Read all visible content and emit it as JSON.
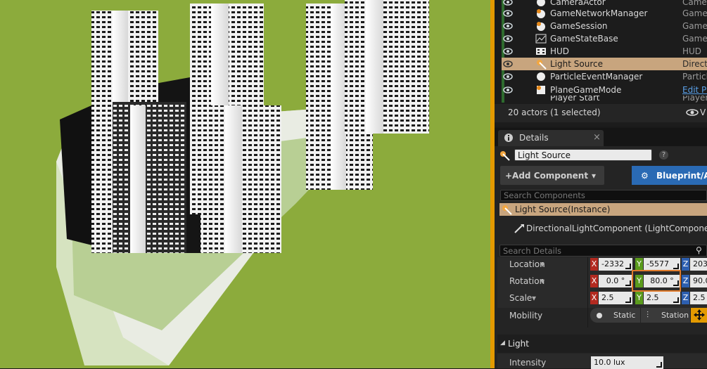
{
  "outliner": {
    "rows": [
      {
        "name": "CameraActor",
        "type": "Came",
        "icon": "camera-actor-icon"
      },
      {
        "name": "GameNetworkManager",
        "type": "GameN",
        "icon": "game-network-manager-icon"
      },
      {
        "name": "GameSession",
        "type": "GameS",
        "icon": "game-session-icon"
      },
      {
        "name": "GameStateBase",
        "type": "GameS",
        "icon": "game-state-icon"
      },
      {
        "name": "HUD",
        "type": "HUD",
        "icon": "hud-icon"
      },
      {
        "name": "Light Source",
        "type": "Directio",
        "icon": "light-source-icon",
        "selected": true
      },
      {
        "name": "ParticleEventManager",
        "type": "Particl",
        "icon": "particle-manager-icon"
      },
      {
        "name": "PlaneGameMode",
        "type": "Edit Pl",
        "icon": "game-mode-icon",
        "link": true
      },
      {
        "name": "Player Start",
        "type": "Player",
        "icon": "player-start-icon"
      }
    ],
    "status": "20 actors (1 selected)",
    "view_options": "V"
  },
  "details": {
    "tab_label": "Details",
    "actor_name": "Light Source",
    "help": "?",
    "add_component": "+Add Component",
    "blueprint": "Blueprint/A",
    "search_components_placeholder": "Search Components",
    "instance_label": "Light Source(Instance)",
    "component_label": "DirectionalLightComponent (LightComponent0)",
    "search_details_placeholder": "Search Details",
    "transform": {
      "location": {
        "label": "Location",
        "x": "-2332",
        "y": "-5577",
        "z": "203"
      },
      "rotation": {
        "label": "Rotation",
        "x": "0.0 °",
        "y": "80.0 °",
        "z": "90.0"
      },
      "scale": {
        "label": "Scale",
        "x": "2.5",
        "y": "2.5",
        "z": "2.5"
      }
    },
    "mobility": {
      "label": "Mobility",
      "static": "Static",
      "stationary": "Station"
    },
    "light_section": "Light",
    "intensity": {
      "label": "Intensity",
      "value": "10.0 lux"
    }
  },
  "colors": {
    "accent": "#e39a00",
    "selected_row": "#c8a57e",
    "viewport_ground": "#8cab3c"
  }
}
